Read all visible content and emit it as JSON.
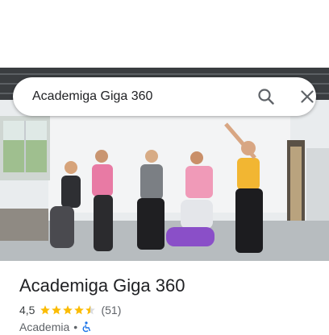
{
  "search": {
    "query": "Academiga Giga 360"
  },
  "place": {
    "name": "Academiga Giga 360",
    "rating": "4,5",
    "stars_filled": 4.5,
    "reviews": "(51)",
    "category": "Academia",
    "separator": "•"
  },
  "icons": {
    "search": "search-icon",
    "close": "close-icon",
    "star": "star-icon",
    "accessibility": "wheelchair-icon"
  },
  "colors": {
    "star": "#FBBC04",
    "accessibility": "#1A73E8"
  }
}
